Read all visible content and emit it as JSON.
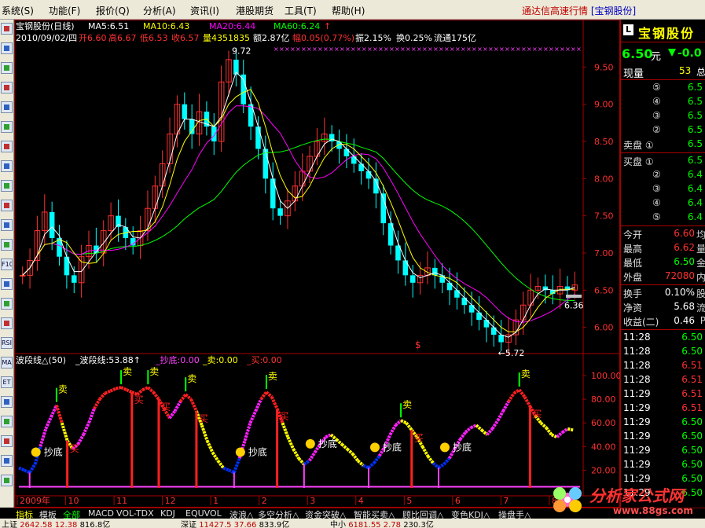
{
  "menu": {
    "items": [
      "系统(S)",
      "功能(F)",
      "报价(Q)",
      "分析(A)",
      "资讯(I)",
      "港股期货",
      "工具(T)",
      "帮助(H)"
    ],
    "brand": "通达信高速行情",
    "stock_bracket": "[宝钢股份]"
  },
  "toolbar": {
    "icons": [
      "candlestick-icon",
      "line-chart-icon",
      "grid-icon",
      "bar-chart-icon",
      "table-icon",
      "list-icon",
      "news-icon",
      "bars-icon",
      "user-icon",
      "list2-icon",
      "finance-icon",
      "info-icon",
      "f10-icon",
      "vol-icon",
      "chart-icon",
      "wave-icon",
      "rsi-icon",
      "ma-icon",
      "calc-icon",
      "cross-icon",
      "pen-icon",
      "plus-icon",
      "up-arrow-icon",
      "down-arrow-icon"
    ],
    "labels": [
      "",
      "",
      "",
      "",
      "",
      "",
      "",
      "",
      "",
      "",
      "",
      "",
      "F10",
      "",
      "",
      "",
      "RSI",
      "MA",
      "ET",
      "",
      "",
      "",
      "",
      ""
    ]
  },
  "chart_header": {
    "line1": {
      "name": "宝钢股份(日线)",
      "ma5": "MA5:6.51",
      "ma10": "MA10:6.43",
      "ma20": "MA20:6.44",
      "ma60": "MA60:6.24",
      "up_arrow": "↑"
    },
    "line2": {
      "date": "2010/09/02/四",
      "open": "开6.60",
      "high": "高6.67",
      "low": "低6.53",
      "close": "收6.57",
      "volume": "量4351835",
      "amount": "额2.87亿",
      "change": "幅0.05(0.77%)",
      "amplitude": "振2.15%",
      "turnover": "换0.25%",
      "float": "流通175亿"
    }
  },
  "chart_data": [
    {
      "type": "candlestick",
      "title": "宝钢股份(日线)",
      "ylim": [
        5.7,
        9.8
      ],
      "yticks": [
        "9.50",
        "9.00",
        "8.50",
        "8.00",
        "7.50",
        "7.00",
        "6.50",
        "6.00"
      ],
      "ytick_values": [
        9.5,
        9.0,
        8.5,
        8.0,
        7.5,
        7.0,
        6.5,
        6.0
      ],
      "annotations": {
        "high_label": "9.72",
        "low_label": "←5.72",
        "last_label": "6.36"
      },
      "x_months": [
        "2009年",
        "10",
        "11",
        "12",
        "1",
        "2",
        "3",
        "4",
        "5",
        "6",
        "7",
        "8"
      ],
      "close_series": [
        6.7,
        6.9,
        7.3,
        7.55,
        7.2,
        6.95,
        6.7,
        6.6,
        6.95,
        7.1,
        7.0,
        7.3,
        7.5,
        7.35,
        7.2,
        7.1,
        7.3,
        7.6,
        7.9,
        8.2,
        8.6,
        9.0,
        8.8,
        8.6,
        8.9,
        8.7,
        8.5,
        9.3,
        9.6,
        9.4,
        9.0,
        8.7,
        8.4,
        8.0,
        7.6,
        7.5,
        7.7,
        7.9,
        8.1,
        8.3,
        8.5,
        8.6,
        8.5,
        8.4,
        8.3,
        8.2,
        8.1,
        8.0,
        7.8,
        7.4,
        7.1,
        6.9,
        6.7,
        6.6,
        6.7,
        6.8,
        6.7,
        6.6,
        6.5,
        6.4,
        6.3,
        6.2,
        6.1,
        6.0,
        5.9,
        5.8,
        5.9,
        6.1,
        6.3,
        6.5,
        6.55,
        6.5,
        6.45,
        6.55,
        6.5,
        6.57
      ],
      "ma_series": [
        {
          "name": "MA5",
          "color": "#ffffff"
        },
        {
          "name": "MA10",
          "color": "#ffff00"
        },
        {
          "name": "MA20",
          "color": "#ff00ff"
        },
        {
          "name": "MA60",
          "color": "#00ff00"
        }
      ]
    },
    {
      "type": "line",
      "title": "波段线△(50)",
      "ylim": [
        5,
        110
      ],
      "yticks": [
        "100.00",
        "80.00",
        "60.00",
        "40.00",
        "20.00"
      ],
      "ytick_values": [
        100,
        80,
        60,
        40,
        20
      ],
      "series": [
        {
          "name": "波段线",
          "last": "53.88"
        },
        {
          "name": "抄底",
          "last": "0.00"
        },
        {
          "name": "卖",
          "last": "0.00"
        },
        {
          "name": "买",
          "last": "0.00"
        }
      ],
      "values": [
        22,
        20,
        18,
        25,
        40,
        55,
        65,
        75,
        60,
        45,
        38,
        42,
        50,
        60,
        72,
        80,
        85,
        87,
        89,
        90,
        88,
        86,
        84,
        88,
        90,
        86,
        80,
        72,
        64,
        70,
        78,
        84,
        80,
        70,
        58,
        45,
        35,
        28,
        22,
        20,
        18,
        30,
        45,
        60,
        70,
        80,
        86,
        82,
        72,
        60,
        48,
        38,
        30,
        25,
        28,
        35,
        42,
        48,
        50,
        46,
        42,
        38,
        34,
        28,
        24,
        22,
        26,
        32,
        40,
        50,
        58,
        62,
        60,
        54,
        48,
        40,
        32,
        26,
        22,
        25,
        30,
        38,
        46,
        52,
        56,
        58,
        54,
        50,
        55,
        62,
        70,
        78,
        85,
        88,
        82,
        74,
        66,
        60,
        56,
        50,
        48,
        52,
        55,
        53.88
      ],
      "text_markers": [
        "卖",
        "买",
        "抄底",
        "底"
      ]
    }
  ],
  "indicator_header": {
    "title": "波段线△(50)",
    "v1": "_波段线:53.88↑",
    "v2": "_抄底:0.00",
    "v3": "_卖:0.00",
    "v4": "_买:0.00"
  },
  "right_panel": {
    "name_icon": "L",
    "stock_name": "宝钢股份",
    "price": "6.50",
    "price_unit": "元",
    "change": "-0.0",
    "change_icon": "down-triangle-icon",
    "now_label": "现量",
    "now_value": "53",
    "now_extra": "总",
    "sell_levels": [
      {
        "label": "⑤",
        "price": "6.5"
      },
      {
        "label": "④",
        "price": "6.5"
      },
      {
        "label": "③",
        "price": "6.5"
      },
      {
        "label": "②",
        "price": "6.5"
      },
      {
        "label": "卖盘 ①",
        "price": "6.5"
      }
    ],
    "buy_levels": [
      {
        "label": "买盘 ①",
        "price": "6.5"
      },
      {
        "label": "②",
        "price": "6.4"
      },
      {
        "label": "③",
        "price": "6.4"
      },
      {
        "label": "④",
        "price": "6.4"
      },
      {
        "label": "⑤",
        "price": "6.4"
      }
    ],
    "stats": [
      {
        "label": "今开",
        "value": "6.60",
        "extra": "均"
      },
      {
        "label": "最高",
        "value": "6.62",
        "extra": "量"
      },
      {
        "label": "最低",
        "value": "6.50",
        "extra": "金"
      },
      {
        "label": "外盘",
        "value": "72080",
        "extra": "内"
      }
    ],
    "stats2": [
      {
        "label": "换手",
        "value": "0.10%",
        "extra": "股"
      },
      {
        "label": "净资",
        "value": "5.68",
        "extra": "流"
      },
      {
        "label": "收益(二)",
        "value": "0.46",
        "extra": "P"
      }
    ],
    "ticks": [
      {
        "time": "11:28",
        "price": "6.50"
      },
      {
        "time": "11:28",
        "price": "6.50"
      },
      {
        "time": "11:28",
        "price": "6.51"
      },
      {
        "time": "11:28",
        "price": "6.51"
      },
      {
        "time": "11:29",
        "price": "6.51"
      },
      {
        "time": "11:29",
        "price": "6.51"
      },
      {
        "time": "11:29",
        "price": "6.50"
      },
      {
        "time": "11:29",
        "price": "6.50"
      },
      {
        "time": "11:29",
        "price": "6.50"
      },
      {
        "time": "11:29",
        "price": "6.50"
      },
      {
        "time": "11:29",
        "price": "6.50"
      },
      {
        "time": "11:29",
        "price": "6.50"
      }
    ]
  },
  "bottom_tabs": [
    "指标",
    "模板",
    "全部",
    "MACD",
    "VOL-TDX",
    "KDJ",
    "EQUVOL",
    "波浪△",
    "多空分析△",
    "资金突破△",
    "智能买卖△",
    "顾比回调△",
    "变色KDJ△",
    "操盘手△"
  ],
  "statusbar": {
    "sh_label": "上证",
    "sh_value": "2642.58",
    "sh_change": "12.38",
    "sh_amount": "816.8亿",
    "sz_label": "深证",
    "sz_value": "11427.5",
    "sz_change": "37.66",
    "sz_amount": "833.9亿",
    "zx_label": "中小",
    "zx_value": "6181.55",
    "zx_change": "2.78",
    "zx_amount": "230.3亿"
  },
  "watermark": {
    "text": "分析家公式网",
    "url": "www.88gs.com"
  },
  "colors": {
    "up": "#ff3030",
    "down": "#00ffff",
    "ma5": "#ffffff",
    "ma10": "#ffff00",
    "ma20": "#ff00ff",
    "ma60": "#00ff00",
    "grid_border": "#aa0000",
    "bg": "#000000",
    "menu_bg": "#ece9d8"
  }
}
